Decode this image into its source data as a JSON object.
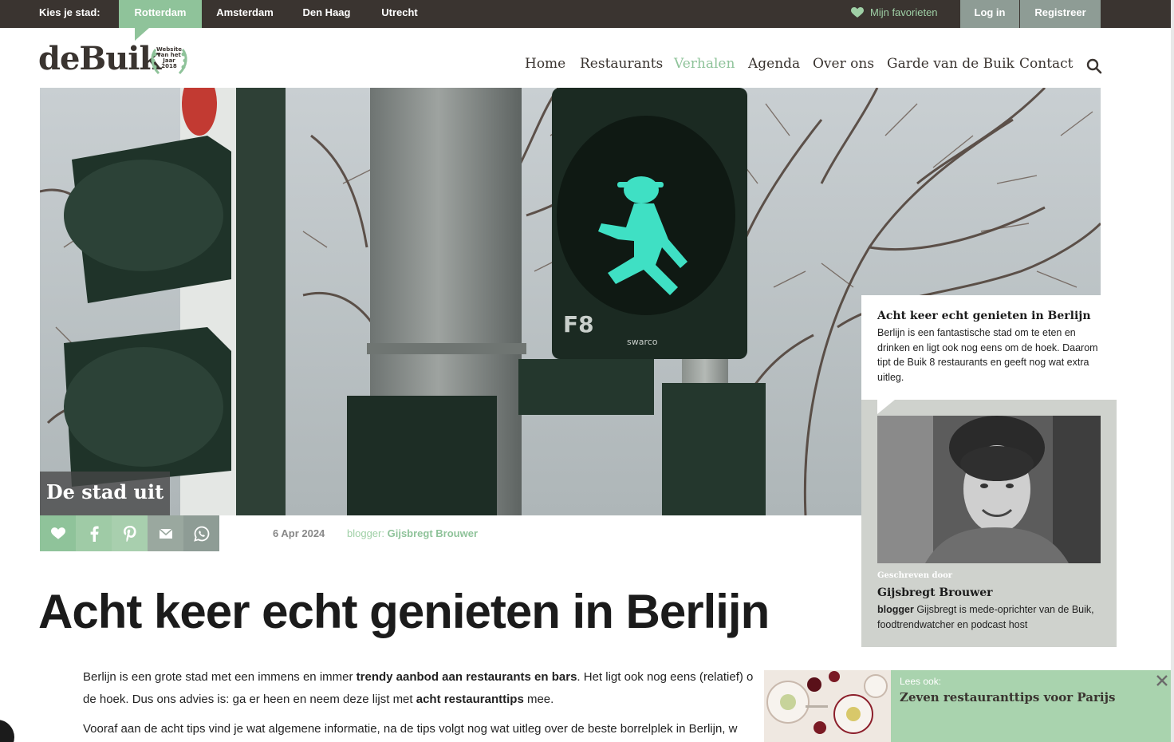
{
  "topbar": {
    "city_label": "Kies je stad:",
    "cities": [
      "Rotterdam",
      "Amsterdam",
      "Den Haag",
      "Utrecht"
    ],
    "active_city": "Rotterdam",
    "favorites": "Mijn favorieten",
    "login": "Log in",
    "register": "Registreer"
  },
  "logo": {
    "text": "deBuik",
    "award_line1": "Website",
    "award_line2": "van het",
    "award_line3": "Jaar",
    "award_line4": "2018"
  },
  "nav": {
    "items": [
      "Home",
      "Restaurants",
      "Verhalen",
      "Agenda",
      "Over ons",
      "Garde van de Buik",
      "Contact"
    ],
    "active": "Verhalen",
    "search_icon": "search-icon"
  },
  "hero": {
    "category_tag": "De stad uit",
    "light_label": "F8",
    "brand_label": "swarco"
  },
  "share": {
    "icons": [
      "heart-icon",
      "facebook-icon",
      "pinterest-icon",
      "mail-icon",
      "whatsapp-icon"
    ],
    "colors": [
      "#8fc39a",
      "#9fcba6",
      "#a8cfae",
      "#9aa89f",
      "#8e9c95"
    ]
  },
  "meta": {
    "date": "6 Apr 2024",
    "blogger_label": "blogger:",
    "blogger_name": "Gijsbregt Brouwer"
  },
  "article": {
    "title": "Acht keer echt genieten in Berlijn",
    "p1_a": "Berlijn is een grote stad met een immens en immer ",
    "p1_b": "trendy aanbod aan restaurants en bars",
    "p1_c": ". Het ligt ook nog eens (relatief) o",
    "p1_d": "de hoek. Dus ons advies is: ga er heen en neem deze lijst met ",
    "p1_e": "acht restauranttips",
    "p1_f": " mee.",
    "p2": "Vooraf aan de acht tips vind je wat algemene informatie, na de tips volgt nog wat uitleg over de beste borrelplek in Berlijn, w"
  },
  "sidebar": {
    "card_title": "Acht keer echt genieten in Berlijn",
    "card_desc": "Berlijn is een fantastische stad om te eten en drinken en ligt ook nog eens om de hoek. Daarom tipt de Buik 8 restaurants en geeft nog wat extra uitleg.",
    "written_by": "Geschreven door",
    "author_name": "Gijsbregt Brouwer",
    "author_role": "blogger",
    "author_bio": " Gijsbregt is mede-oprichter van de Buik, foodtrendwatcher en podcast host"
  },
  "popup": {
    "lees_ook": "Lees ook:",
    "title": "Zeven restauranttips voor Parijs"
  },
  "colors": {
    "accent_green": "#8fc39a",
    "topbar_dark": "#3a3430",
    "button_grey": "#8e9c95",
    "author_bg": "#cfd2cd",
    "popup_green": "#a9d3ae"
  }
}
